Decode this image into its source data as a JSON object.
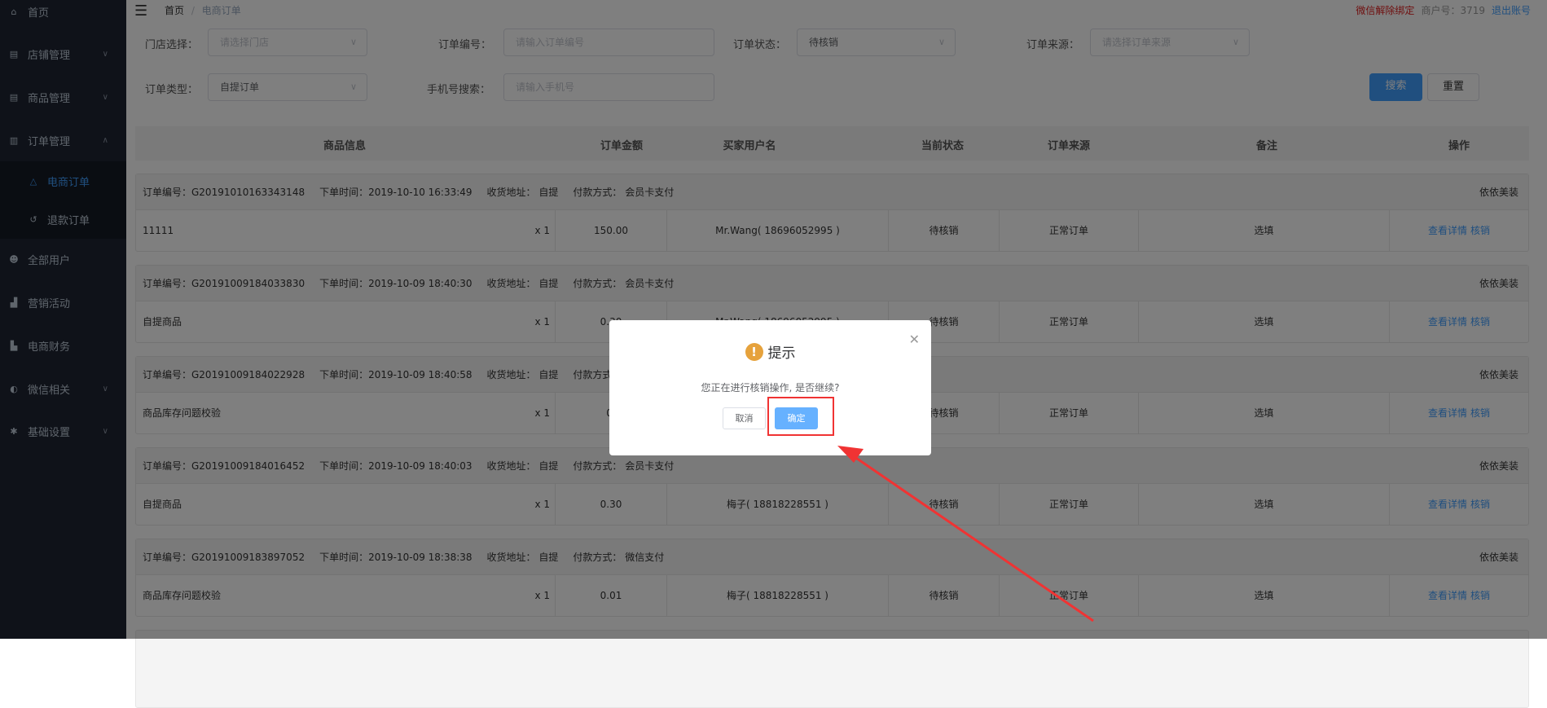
{
  "sidebar": {
    "items": [
      {
        "label": "首页",
        "icon": "home-icon"
      },
      {
        "label": "店铺管理",
        "icon": "store-icon",
        "chevron": "down"
      },
      {
        "label": "商品管理",
        "icon": "goods-icon",
        "chevron": "down"
      },
      {
        "label": "订单管理",
        "icon": "clipboard-icon",
        "chevron": "up"
      },
      {
        "label": "电商订单",
        "icon": "bell-icon",
        "active": true
      },
      {
        "label": "退款订单",
        "icon": "refund-icon"
      },
      {
        "label": "全部用户",
        "icon": "users-icon"
      },
      {
        "label": "营销活动",
        "icon": "chart-icon"
      },
      {
        "label": "电商财务",
        "icon": "finance-icon"
      },
      {
        "label": "微信相关",
        "icon": "wechat-icon",
        "chevron": "down"
      },
      {
        "label": "基础设置",
        "icon": "gear-icon",
        "chevron": "down"
      }
    ]
  },
  "header": {
    "breadcrumb_home": "首页",
    "breadcrumb_sep": "/",
    "breadcrumb_current": "电商订单",
    "unbind": "微信解除绑定",
    "merchant": "商户号：3719",
    "logout": "退出账号"
  },
  "filters": {
    "store": {
      "label": "门店选择：",
      "placeholder": "请选择门店"
    },
    "order_no": {
      "label": "订单编号：",
      "placeholder": "请输入订单编号"
    },
    "status": {
      "label": "订单状态：",
      "value": "待核销"
    },
    "source": {
      "label": "订单来源：",
      "placeholder": "请选择订单来源"
    },
    "type": {
      "label": "订单类型：",
      "value": "自提订单"
    },
    "phone": {
      "label": "手机号搜索：",
      "placeholder": "请输入手机号"
    },
    "search": "搜索",
    "reset": "重置"
  },
  "table": {
    "headers": [
      "商品信息",
      "订单金额",
      "买家用户名",
      "当前状态",
      "订单来源",
      "备注",
      "操作"
    ],
    "orders": [
      {
        "no": "订单编号：G20191010163343148",
        "time": "下单时间：2019-10-10 16:33:49",
        "addr": "收货地址： 自提",
        "pay": "付款方式： 会员卡支付",
        "shop": "依依美装",
        "product": "11111",
        "qty": "x 1",
        "amount": "150.00",
        "buyer": "Mr.Wang( 18696052995 )",
        "status": "待核销",
        "source": "正常订单",
        "remark": "选填",
        "view": "查看详情",
        "verify": "核销"
      },
      {
        "no": "订单编号：G20191009184033830",
        "time": "下单时间：2019-10-09 18:40:30",
        "addr": "收货地址： 自提",
        "pay": "付款方式： 会员卡支付",
        "shop": "依依美装",
        "product": "自提商品",
        "qty": "x 1",
        "amount": "0.30",
        "buyer": "Mr.Wang( 18696052995 )",
        "status": "待核销",
        "source": "正常订单",
        "remark": "选填",
        "view": "查看详情",
        "verify": "核销"
      },
      {
        "no": "订单编号：G20191009184022928",
        "time": "下单时间：2019-10-09 18:40:58",
        "addr": "收货地址： 自提",
        "pay": "付款方式",
        "shop": "依依美装",
        "product": "商品库存问题校验",
        "qty": "x 1",
        "amount": "0.",
        "buyer": "",
        "status": "待核销",
        "source": "正常订单",
        "remark": "选填",
        "view": "查看详情",
        "verify": "核销"
      },
      {
        "no": "订单编号：G20191009184016452",
        "time": "下单时间：2019-10-09 18:40:03",
        "addr": "收货地址： 自提",
        "pay": "付款方式： 会员卡支付",
        "shop": "依依美装",
        "product": "自提商品",
        "qty": "x 1",
        "amount": "0.30",
        "buyer": "梅子( 18818228551 )",
        "status": "待核销",
        "source": "正常订单",
        "remark": "选填",
        "view": "查看详情",
        "verify": "核销"
      },
      {
        "no": "订单编号：G20191009183897052",
        "time": "下单时间：2019-10-09 18:38:38",
        "addr": "收货地址： 自提",
        "pay": "付款方式： 微信支付",
        "shop": "依依美装",
        "product": "商品库存问题校验",
        "qty": "x 1",
        "amount": "0.01",
        "buyer": "梅子( 18818228551 )",
        "status": "待核销",
        "source": "正常订单",
        "remark": "选填",
        "view": "查看详情",
        "verify": "核销"
      }
    ]
  },
  "dialog": {
    "title": "提示",
    "message": "您正在进行核销操作, 是否继续?",
    "cancel": "取消",
    "confirm": "确定",
    "icon": "warning-icon"
  },
  "colors": {
    "accent": "#409eff",
    "warning": "#e6a23c",
    "annotation": "#f03333",
    "sidebar": "#1f2533"
  }
}
